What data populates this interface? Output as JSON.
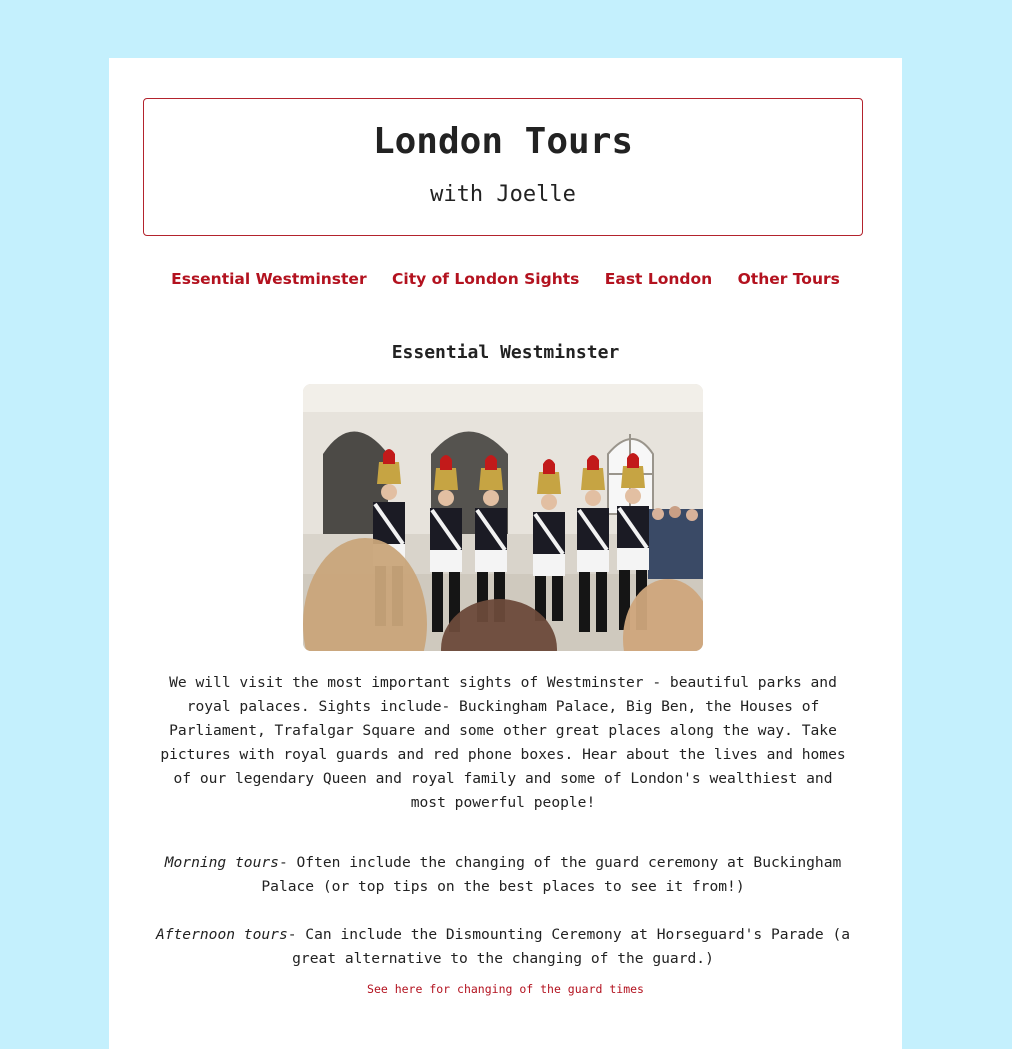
{
  "header": {
    "title": "London Tours",
    "subtitle": "with Joelle"
  },
  "nav": {
    "items": [
      "Essential Westminster",
      "City of London Sights",
      "East London",
      "Other Tours"
    ]
  },
  "section": {
    "title": "Essential Westminster",
    "photo_alt": "Household Cavalry guards at Horse Guards Parade",
    "intro": "We will visit the most important sights of Westminster - beautiful parks and royal palaces. Sights include- Buckingham Palace, Big Ben, the Houses of Parliament, Trafalgar Square and some other great places along the way. Take pictures with royal guards and red phone boxes. Hear about the lives and homes of our legendary Queen and royal family and some of London's wealthiest and most powerful people!",
    "morning_label": "Morning tours",
    "morning_text": "- Often include the changing of the guard ceremony at Buckingham Palace (or top tips on the best places to see it from!)",
    "afternoon_label": "Afternoon tours",
    "afternoon_text": "- Can include the Dismounting Ceremony at Horseguard's Parade (a great alternative to the changing of the guard.)",
    "link_text": "See here for changing of the guard times"
  },
  "colors": {
    "page_background": "#c4f0fd",
    "card_background": "#ffffff",
    "accent_red": "#b3121f",
    "text": "#222222"
  }
}
